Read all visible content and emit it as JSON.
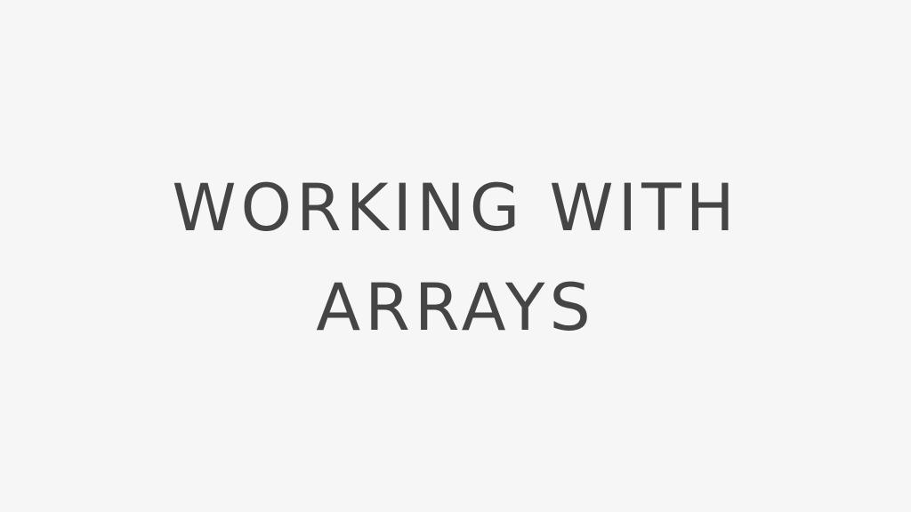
{
  "slide": {
    "title_line_1": "WORKING WITH",
    "title_line_2": "ARRAYS"
  },
  "colors": {
    "background": "#f6f6f6",
    "text": "#454545"
  }
}
